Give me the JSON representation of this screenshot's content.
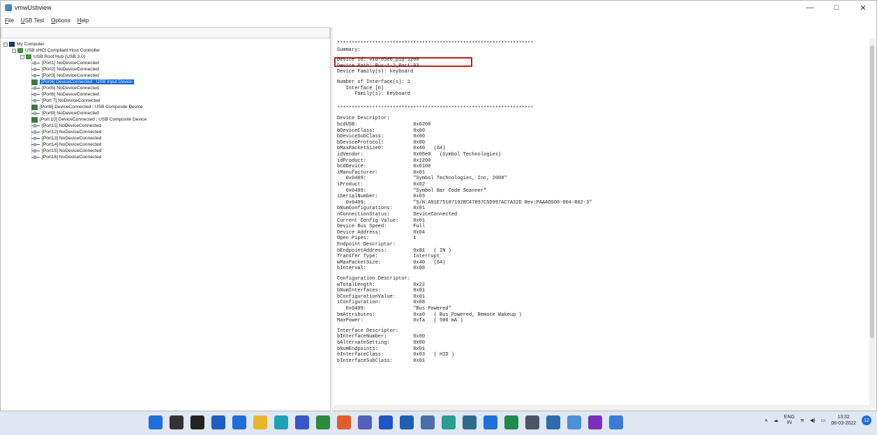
{
  "window": {
    "title": "vmwUsbview",
    "minimize": "—",
    "maximize": "□",
    "close": "✕"
  },
  "menu": [
    {
      "label": "File",
      "u": "F",
      "rest": "ile"
    },
    {
      "label": "USB Test",
      "u": "U",
      "rest": "SB Test"
    },
    {
      "label": "Options",
      "u": "O",
      "rest": "ptions"
    },
    {
      "label": "Help",
      "u": "H",
      "rest": "elp"
    }
  ],
  "tree": {
    "root": "My Computer",
    "controller": "USB xHCI Compliant Host Controller",
    "hub": "USB Root Hub (USB 3.0)",
    "ports": [
      {
        "label": "[Port1] NoDeviceConnected",
        "connected": false
      },
      {
        "label": "[Port2] NoDeviceConnected",
        "connected": false
      },
      {
        "label": "[Port3] NoDeviceConnected",
        "connected": false
      },
      {
        "label": "[Port4] DeviceConnected : USB Input Device",
        "connected": true,
        "selected": true
      },
      {
        "label": "[Port5] NoDeviceConnected",
        "connected": false
      },
      {
        "label": "[Port6] NoDeviceConnected",
        "connected": false
      },
      {
        "label": "[Port 7] NoDeviceConnected",
        "connected": false
      },
      {
        "label": "[Port8] DeviceConnected : USB Composite Device",
        "connected": true
      },
      {
        "label": "[Port9] NoDeviceConnected",
        "connected": false
      },
      {
        "label": "[Port 10] DeviceConnected : USB Composite Device",
        "connected": true
      },
      {
        "label": "[Port11] NoDeviceConnected",
        "connected": false
      },
      {
        "label": "[Port12] NoDeviceConnected",
        "connected": false
      },
      {
        "label": "[Port13] NoDeviceConnected",
        "connected": false
      },
      {
        "label": "[Port14] NoDeviceConnected",
        "connected": false
      },
      {
        "label": "[Port15] NoDeviceConnected",
        "connected": false
      },
      {
        "label": "[Port16] NoDeviceConnected",
        "connected": false
      }
    ]
  },
  "details": [
    "*******************************************************************",
    "Summary:",
    "",
    "Device Id: vid-05e0_pid-1200",
    "Device Path: Bus-1-2_Port-03",
    "Device Family(s): keyboard",
    "",
    "Number of Interface(s): 1",
    "   Interface [0]",
    "      Family(s): keyboard",
    "",
    "",
    "*******************************************************************",
    "",
    "Device Descriptor:",
    "bcdUSB:                   0x0200",
    "bDeviceClass:             0x00",
    "bDeviceSubClass:          0x00",
    "bDeviceProtocol:          0x00",
    "bMaxPacketSize0:          0x40   (64)",
    "idVendor:                 0x05e0   (Symbol Technologies)",
    "idProduct:                0x1200",
    "bcdDevice:                0x0100",
    "iManufacturer:            0x01",
    "   0x0409:                \"Symbol Technologies, Inc, 2008\"",
    "iProduct:                 0x02",
    "   0x0409:                \"Symbol Bar Code Scanner\"",
    "iSerialNumber:            0x03",
    "   0x0409:                \"S/N:A91E75187192BC47897C5D997AC7A32D Rev:PAAAOS00-004-R02-3\"",
    "bNumConfigurations:       0x01",
    "nConnectionStatus:        DeviceConnected",
    "Current Config Value:     0x01",
    "Device Bus Speed:         Full",
    "Device Address:           0x04",
    "Open Pipes:               1",
    "Endpoint Descriptor:",
    "bEndpointAddress:         0x81   ( IN )",
    "Transfer Type:            Interrupt",
    "wMaxPacketSize:           0x40   (64)",
    "bInterval:                0x08",
    "",
    "Configuration Descriptor:",
    "wTotalLength:             0x22",
    "bNumInterfaces:           0x01",
    "bConfigurationValue:      0x01",
    "iConfiguration:           0x08",
    "   0x0409:                \"Bus Powered\"",
    "bmAttributes:             0xa0   ( Bus Powered, Remote Wakeup )",
    "MaxPower:                 0xfa   ( 500 mA )",
    "",
    "Interface Descriptor:",
    "bInterfaceNumber:         0x00",
    "bAlternateSetting:        0x00",
    "bNumEndpoints:            0x01",
    "bInterfaceClass:          0x03   ( HID )",
    "bInterfaceSubClass:       0x01"
  ],
  "taskbar": {
    "apps": [
      "start-icon",
      "search-icon",
      "task-view-icon",
      "widgets-icon",
      "chat-icon",
      "file-explorer-icon",
      "edge-icon",
      "store-icon",
      "chrome-icon",
      "firefox-icon",
      "app-a-icon",
      "dropbox-icon",
      "word-icon",
      "notepad-icon",
      "paint-icon",
      "calculator-icon",
      "camera-icon",
      "sheets-icon",
      "check-icon",
      "photos-icon",
      "usbview-icon",
      "visio-icon",
      "settings-icon"
    ],
    "app_colors": [
      "#1e6fd9",
      "#333333",
      "#222222",
      "#1f5fbf",
      "#1e6fd9",
      "#e8b62c",
      "#1fa1b8",
      "#3a56c9",
      "#2b8a3e",
      "#e35b2a",
      "#5560b8",
      "#1f55c7",
      "#1e5fb8",
      "#4a6fa8",
      "#2a9d8f",
      "#2e6b8a",
      "#1e6fd9",
      "#1f8b4c",
      "#4a5568",
      "#2b6cb0",
      "#4a90d9",
      "#7b2fbe",
      "#3a7ad9"
    ],
    "lang": "ENG",
    "region": "IN",
    "time": "13:32",
    "date": "08-03-2022",
    "notifications": "12"
  }
}
